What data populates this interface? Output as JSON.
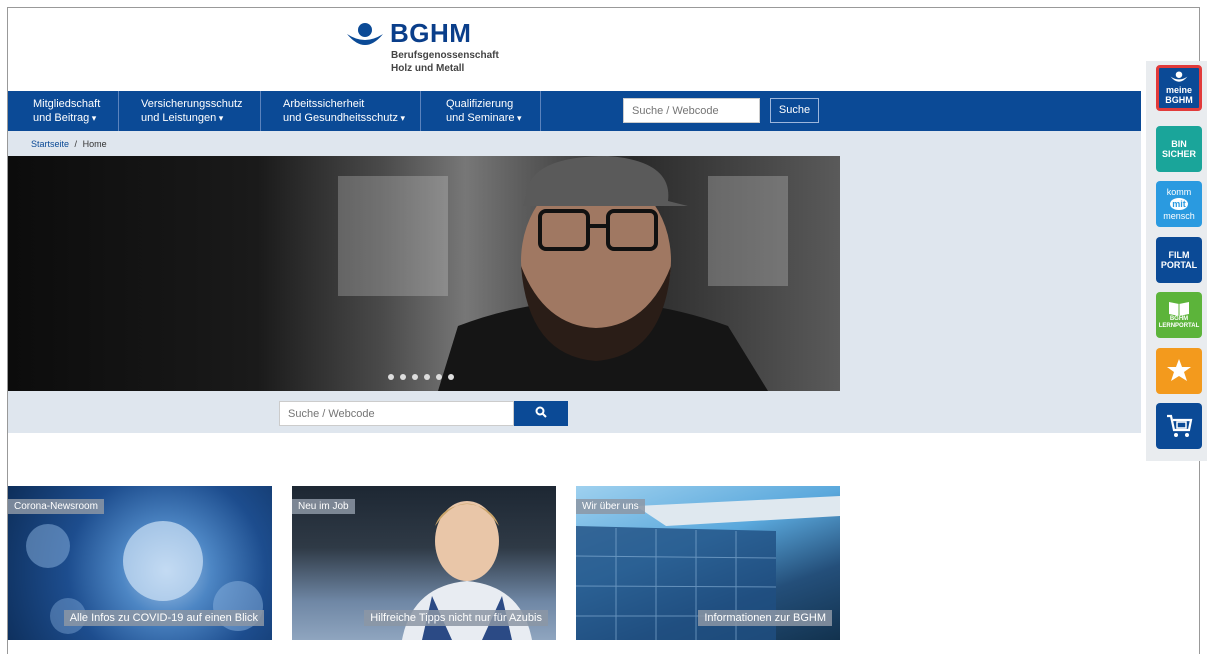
{
  "logo": {
    "brand": "BGHM",
    "line1": "Berufsgenossenschaft",
    "line2": "Holz und Metall"
  },
  "nav": {
    "items": [
      {
        "line1": "Mitgliedschaft",
        "line2": "und Beitrag"
      },
      {
        "line1": "Versicherungsschutz",
        "line2": "und Leistungen"
      },
      {
        "line1": "Arbeitssicherheit",
        "line2": "und Gesundheitsschutz"
      },
      {
        "line1": "Qualifizierung",
        "line2": "und Seminare"
      }
    ],
    "search_placeholder": "Suche / Webcode",
    "search_button": "Suche"
  },
  "breadcrumb": {
    "start": "Startseite",
    "separator": "/",
    "current": "Home"
  },
  "hero": {
    "slide_count": 6
  },
  "search2": {
    "placeholder": "Suche / Webcode"
  },
  "teasers": [
    {
      "tag": "Corona-Newsroom",
      "caption": "Alle Infos zu COVID-19 auf einen Blick"
    },
    {
      "tag": "Neu im Job",
      "caption": "Hilfreiche Tipps nicht nur für Azubis"
    },
    {
      "tag": "Wir über uns",
      "caption": "Informationen zur BGHM"
    }
  ],
  "rail": {
    "meine_line1": "meine",
    "meine_line2": "BGHM",
    "bin_line1": "BIN",
    "bin_line2": "SICHER",
    "komm_line1": "komm",
    "komm_line2": "mit",
    "komm_line3": "mensch",
    "film_line1": "FILM",
    "film_line2": "PORTAL",
    "lern_line1": "BGHM",
    "lern_line2": "LERNPORTAL"
  }
}
